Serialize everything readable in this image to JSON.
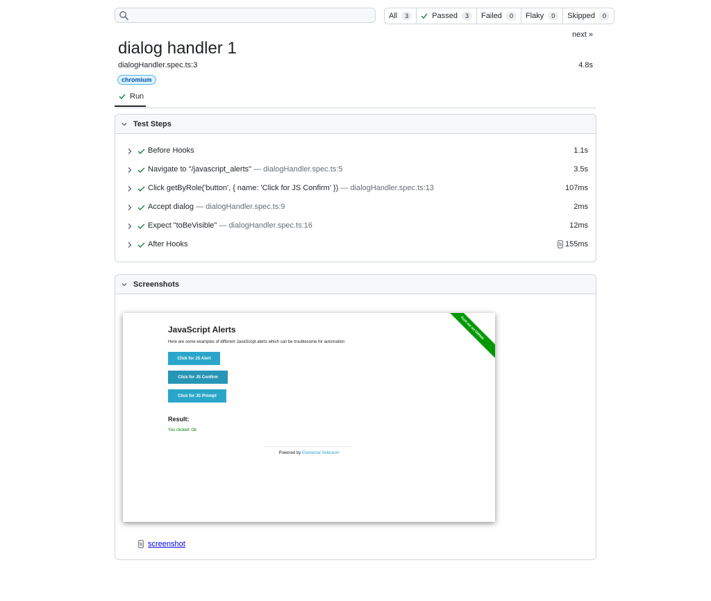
{
  "search": {
    "placeholder": "",
    "value": ""
  },
  "filters": [
    {
      "label": "All",
      "count": "3"
    },
    {
      "label": "Passed",
      "count": "3"
    },
    {
      "label": "Failed",
      "count": "0"
    },
    {
      "label": "Flaky",
      "count": "0"
    },
    {
      "label": "Skipped",
      "count": "0"
    }
  ],
  "nav": {
    "next": "next »"
  },
  "test": {
    "title": "dialog handler 1",
    "location": "dialogHandler.spec.ts:3",
    "duration": "4.8s",
    "project": "chromium"
  },
  "tabs": [
    {
      "label": "Run"
    }
  ],
  "steps_panel": {
    "title": "Test Steps",
    "steps": [
      {
        "label": "Before Hooks",
        "location": "",
        "duration": "1.1s"
      },
      {
        "label": "Navigate to \"/javascript_alerts\"",
        "location": " — dialogHandler.spec.ts:5",
        "duration": "3.5s"
      },
      {
        "label": "Click getByRole('button', { name: 'Click for JS Confirm' })",
        "location": " — dialogHandler.spec.ts:13",
        "duration": "107ms"
      },
      {
        "label": "Accept dialog",
        "location": " — dialogHandler.spec.ts:9",
        "duration": "2ms"
      },
      {
        "label": "Expect \"toBeVisible\"",
        "location": " — dialogHandler.spec.ts:16",
        "duration": "12ms"
      },
      {
        "label": "After Hooks",
        "location": "",
        "duration": "155ms"
      }
    ]
  },
  "screenshots_panel": {
    "title": "Screenshots",
    "page": {
      "heading": "JavaScript Alerts",
      "description": "Here are some examples of different JavaScript alerts which can be troublesome for automation",
      "buttons": [
        "Click for JS Alert",
        "Click for JS Confirm",
        "Click for JS Prompt"
      ],
      "result_heading": "Result:",
      "result_text": "You clicked: Ok",
      "footer_prefix": "Powered by ",
      "footer_link": "Elemental Selenium",
      "ribbon": "Fork me on GitHub"
    },
    "attachment": "screenshot"
  },
  "colors": {
    "pass": "#1a7f37",
    "link": "#0000ee",
    "tag_bg": "#ddf4ff",
    "tag_border": "#54aeff"
  },
  "icons": [
    "search-icon",
    "check-icon",
    "chevron-down-icon",
    "chevron-right-icon",
    "attachment-icon"
  ]
}
